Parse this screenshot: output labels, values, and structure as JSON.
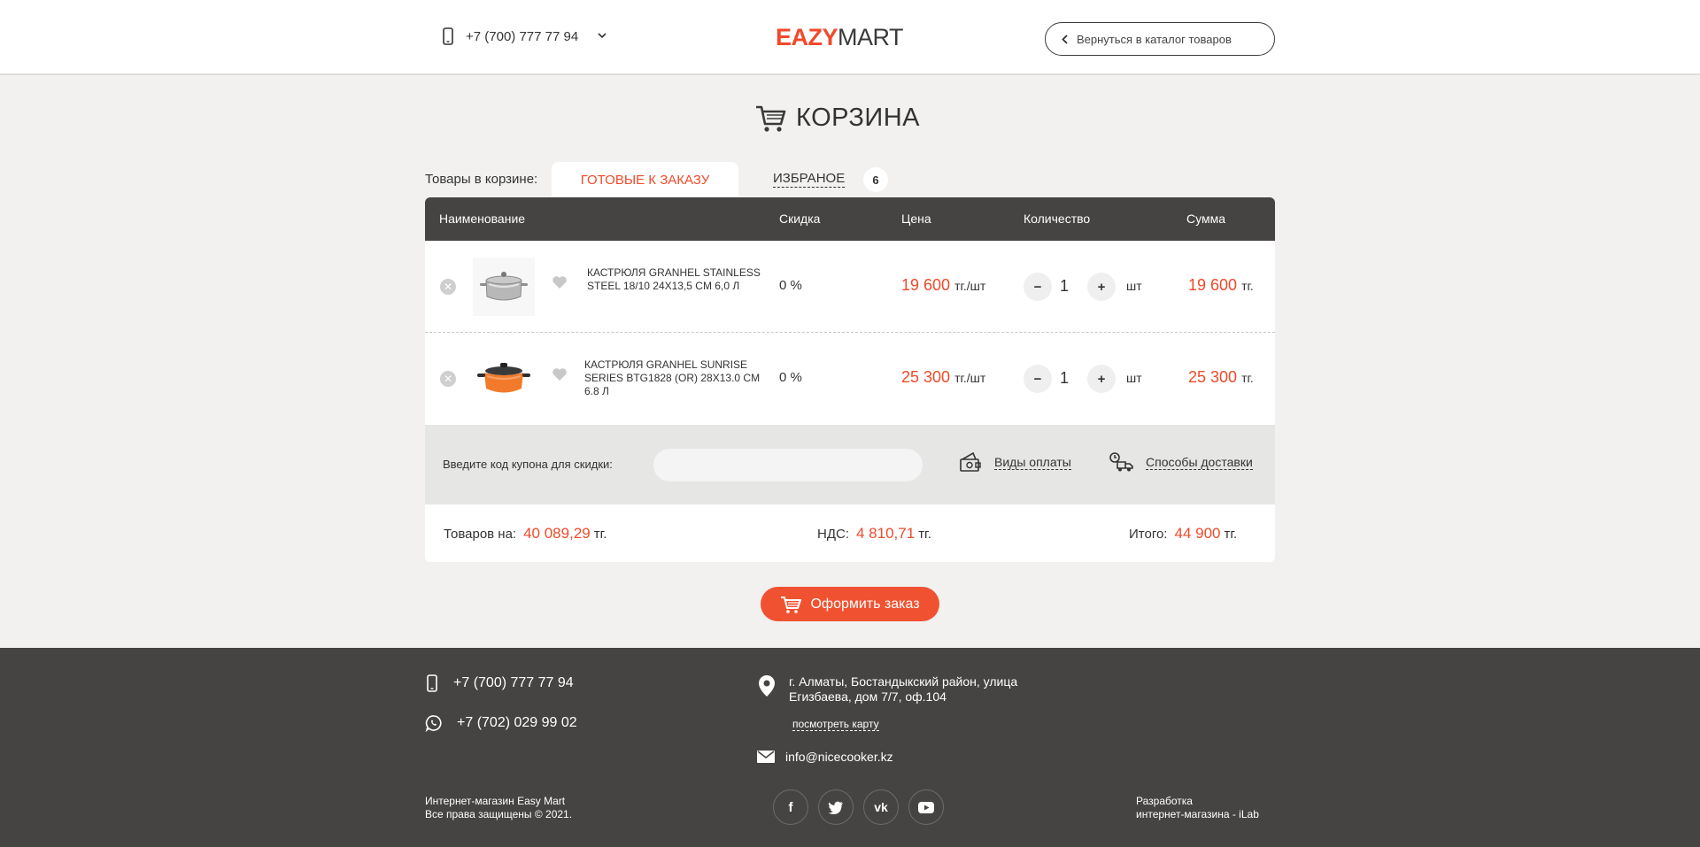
{
  "header": {
    "phone": "+7 (700) 777 77 94",
    "logo_part1": "EAZY",
    "logo_part2": "MART",
    "back_label": "Вернуться в каталог товаров"
  },
  "title": "КОРЗИНА",
  "tabs": {
    "label": "Товары в корзине:",
    "ready": "ГОТОВЫЕ К ЗАКАЗУ",
    "favorites": "ИЗБРАНОЕ",
    "favorites_count": "6"
  },
  "table": {
    "headers": [
      "Наименование",
      "Скидка",
      "Цена",
      "Количество",
      "Сумма"
    ],
    "rows": [
      {
        "name": "КАСТРЮЛЯ GRANHEL STAINLESS STEEL 18/10 24X13,5 CM 6,0 Л",
        "discount": "0 %",
        "price": "19 600",
        "price_unit": "тг./шт",
        "qty": "1",
        "qty_unit": "шт",
        "sum": "19 600",
        "sum_unit": "тг."
      },
      {
        "name": "КАСТРЮЛЯ GRANHEL SUNRISE SERIES BTG1828 (OR) 28X13.0 CM 6.8 Л",
        "discount": "0 %",
        "price": "25 300",
        "price_unit": "тг./шт",
        "qty": "1",
        "qty_unit": "шт",
        "sum": "25 300",
        "sum_unit": "тг."
      }
    ]
  },
  "coupon": {
    "label": "Введите код купона для скидки:",
    "placeholder": "",
    "payment_link": "Виды оплаты",
    "delivery_link": "Способы доставки"
  },
  "totals": {
    "goods_label": "Товаров на:",
    "goods_value": "40 089,29",
    "vat_label": "НДС:",
    "vat_value": "4 810,71",
    "total_label": "Итого:",
    "total_value": "44 900",
    "currency": "тг."
  },
  "order_button": "Оформить заказ",
  "footer": {
    "phone1": "+7 (700) 777 77 94",
    "phone2": "+7 (702) 029 99 02",
    "address_line1": "г. Алматы, Бостандыкский район, улица",
    "address_line2": "Егизбаева, дом 7/7, оф.104",
    "map_link": "посмотреть карту",
    "email": "info@nicecooker.kz",
    "copyright_line1": "Интернет-магазин Easy Mart",
    "copyright_line2": "Все права защищены © 2021.",
    "dev_line1": "Разработка",
    "dev_line2": "интернет-магазина - iLab",
    "socials": [
      "f",
      "t",
      "vk",
      "yt"
    ]
  },
  "colors": {
    "accent": "#ef4a2a",
    "dark": "#454442",
    "background": "#f2f1f0"
  }
}
